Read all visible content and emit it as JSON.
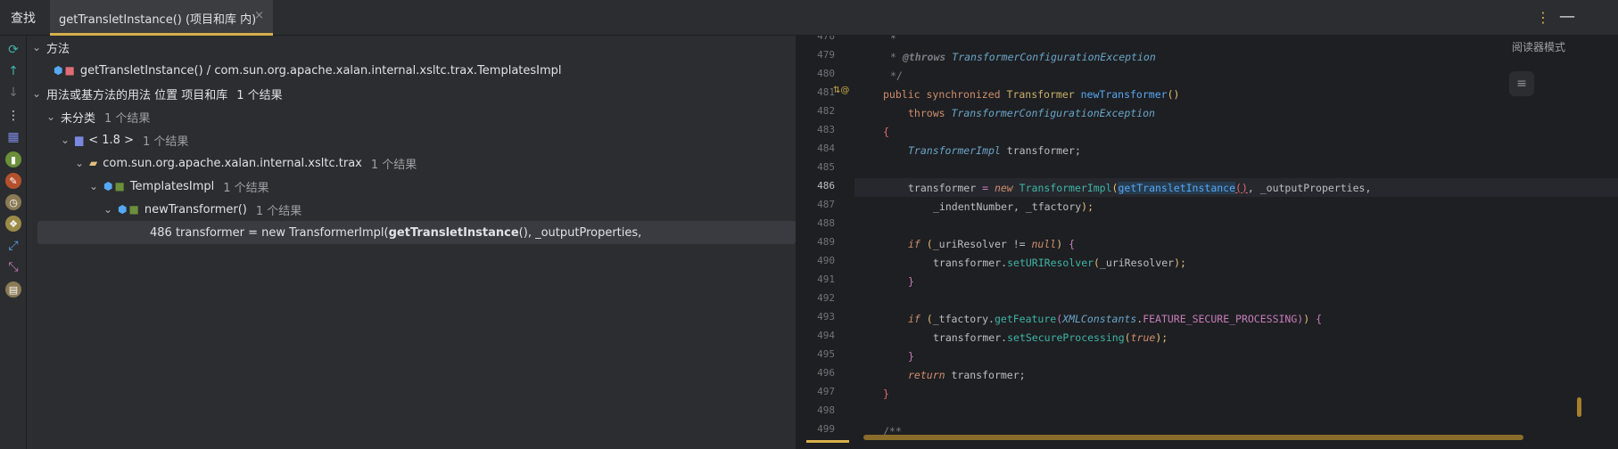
{
  "titlebar": {
    "label": "查找",
    "tab_title": "getTransletInstance() (项目和库 内)",
    "tab_close": "×",
    "more_icon": "⋮",
    "minimize_icon": "—"
  },
  "tree": {
    "methods_header": "方法",
    "method_item": "getTransletInstance() / com.sun.org.apache.xalan.internal.xsltc.trax.TemplatesImpl",
    "usages_header": "用法或基方法的用法 位置 项目和库",
    "usages_count": "1 个结果",
    "uncategorized": "未分类",
    "uncategorized_count": "1 个结果",
    "jdk": "< 1.8 >",
    "jdk_count": "1 个结果",
    "package": "com.sun.org.apache.xalan.internal.xsltc.trax",
    "package_count": "1 个结果",
    "class": "TemplatesImpl",
    "class_count": "1 个结果",
    "method": "newTransformer()",
    "method_count": "1 个结果",
    "result_prefix": "486 transformer = new TransformerImpl(",
    "result_bold": "getTransletInstance",
    "result_suffix": "(), _outputProperties,"
  },
  "editor": {
    "reader_mode": "阅读器模式",
    "lines": [
      {
        "n": "478"
      },
      {
        "n": "479"
      },
      {
        "n": "480"
      },
      {
        "n": "481"
      },
      {
        "n": "482"
      },
      {
        "n": "483"
      },
      {
        "n": "484"
      },
      {
        "n": "485"
      },
      {
        "n": "486"
      },
      {
        "n": "487"
      },
      {
        "n": "488"
      },
      {
        "n": "489"
      },
      {
        "n": "490"
      },
      {
        "n": "491"
      },
      {
        "n": "492"
      },
      {
        "n": "493"
      },
      {
        "n": "494"
      },
      {
        "n": "495"
      },
      {
        "n": "496"
      },
      {
        "n": "497"
      },
      {
        "n": "498"
      },
      {
        "n": "499"
      }
    ],
    "code": {
      "l478": "*",
      "l479_tag": "@throws",
      "l479_val": "TransformerConfigurationException",
      "l480": "*/",
      "l481_public": "public",
      "l481_sync": "synchronized",
      "l481_type": "Transformer",
      "l481_fn": "newTransformer",
      "l482_throws": "throws",
      "l482_type": "TransformerConfigurationException",
      "l483": "{",
      "l484_type": "TransformerImpl",
      "l484_var": "transformer;",
      "l486_var": "transformer",
      "l486_eq": " = ",
      "l486_new": "new",
      "l486_type": "TransformerImpl",
      "l486_call": "getTransletInstance",
      "l486_rest": ", _outputProperties,",
      "l487": "_indentNumber, _tfactory",
      "l489_if": "if",
      "l489_cond": "_uriResolver != ",
      "l489_null": "null",
      "l490_var": "transformer",
      "l490_call": "setURIResolver",
      "l490_arg": "_uriResolver",
      "l491": "}",
      "l493_if": "if",
      "l493_obj": "_tfactory",
      "l493_call": "getFeature",
      "l493_cls": "XMLConstants",
      "l493_const": "FEATURE_SECURE_PROCESSING",
      "l494_var": "transformer",
      "l494_call": "setSecureProcessing",
      "l494_true": "true",
      "l495": "}",
      "l496_ret": "return",
      "l496_var": "transformer;",
      "l497": "}",
      "l499": "/**"
    }
  },
  "colors": {
    "accent": "#d7b04b",
    "background": "#2b2d30",
    "editor_bg": "#1e1f22"
  }
}
